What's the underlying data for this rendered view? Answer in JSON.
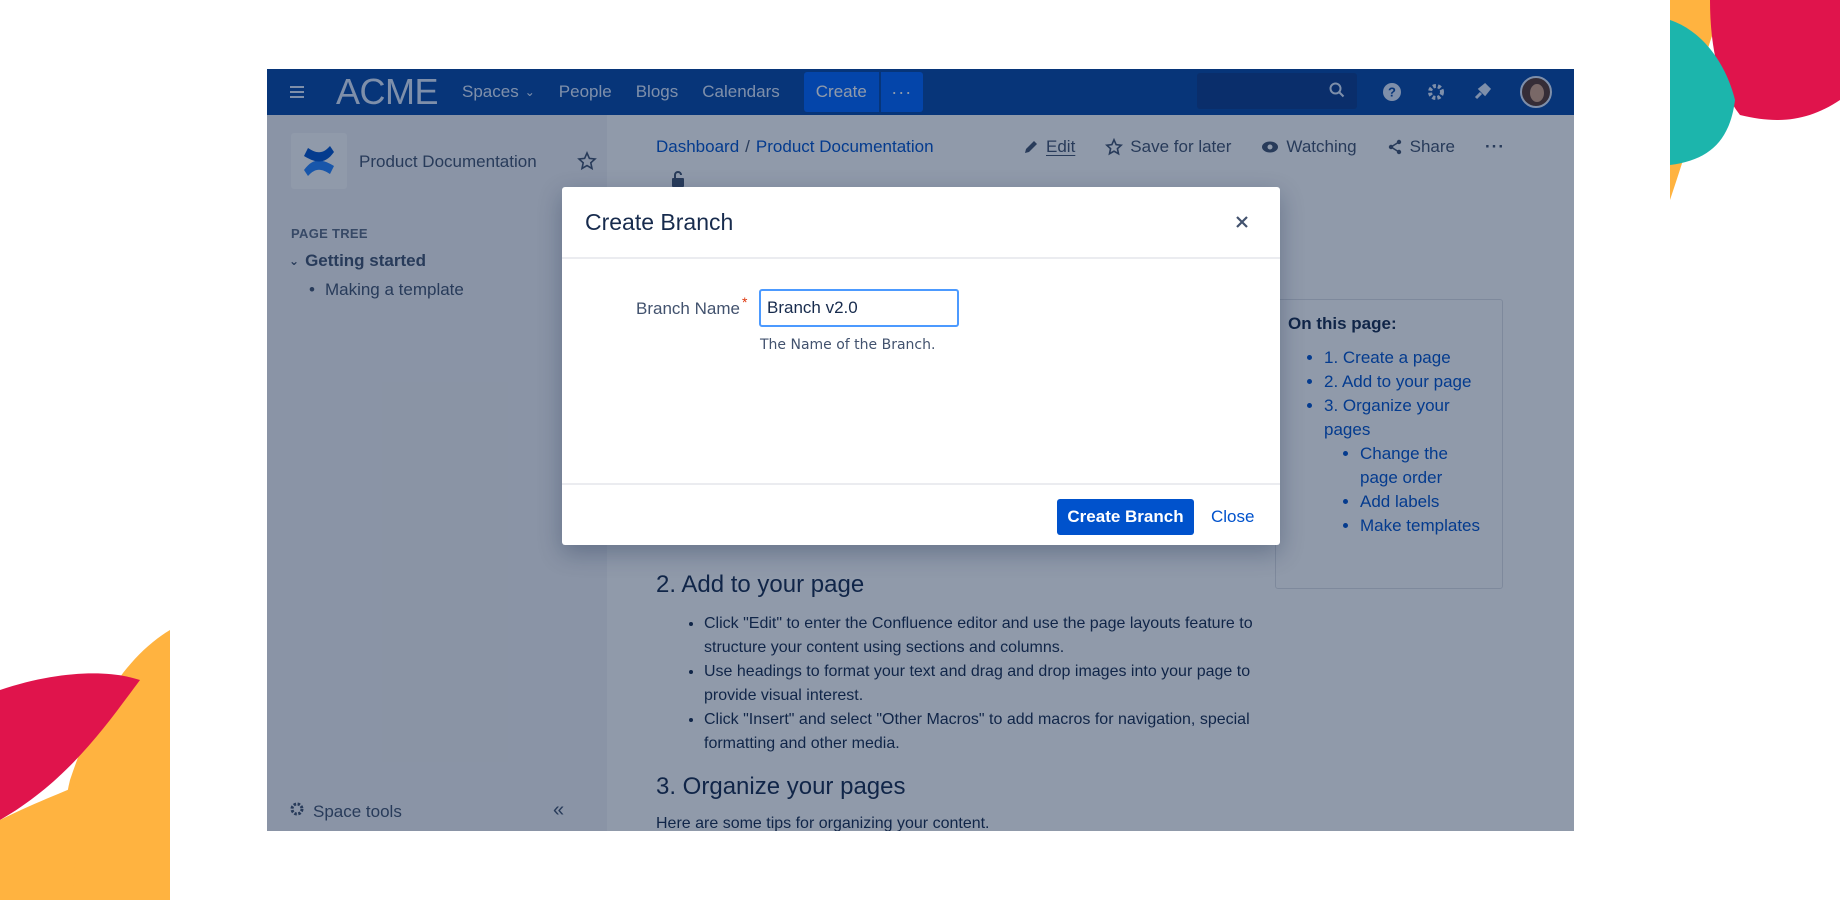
{
  "nav": {
    "logo": "ACME",
    "items": [
      "Spaces",
      "People",
      "Blogs",
      "Calendars"
    ],
    "create_label": "Create",
    "more_label": "···"
  },
  "sidebar": {
    "space_name": "Product Documentation",
    "tree_heading": "PAGE TREE",
    "tree_items": [
      "Getting started",
      "Making a template"
    ],
    "space_tools": "Space tools"
  },
  "main": {
    "breadcrumbs": [
      "Dashboard",
      "Product Documentation"
    ],
    "actions": {
      "edit": "Edit",
      "save": "Save for later",
      "watching": "Watching",
      "share": "Share"
    },
    "section2_title": "2. Add to your page",
    "section2_items": [
      "Click \"Edit\" to enter the Confluence editor and use the page layouts feature to structure your content using sections and columns.",
      "Use headings to format your text and drag and drop images into your page to provide visual interest.",
      "Click \"Insert\" and select \"Other Macros\" to add macros for navigation, special formatting and other media."
    ],
    "section3_title": "3. Organize your pages",
    "section3_intro": "Here are some tips for organizing your content.",
    "toc": {
      "title": "On this page:",
      "items": [
        "1. Create a page",
        "2. Add to your page",
        "3. Organize your pages"
      ],
      "subitems": [
        "Change the page order",
        "Add labels",
        "Make templates"
      ]
    }
  },
  "dialog": {
    "title": "Create Branch",
    "field_label": "Branch Name",
    "required_mark": "*",
    "field_value": "Branch v2.0",
    "field_help": "The Name of the Branch.",
    "primary_button": "Create Branch",
    "close_link": "Close"
  },
  "colors": {
    "nav_bg": "#0747a6",
    "primary": "#0052cc",
    "accent_red": "#e0144c",
    "accent_yellow": "#ffb340",
    "accent_teal": "#1cb5ac"
  }
}
